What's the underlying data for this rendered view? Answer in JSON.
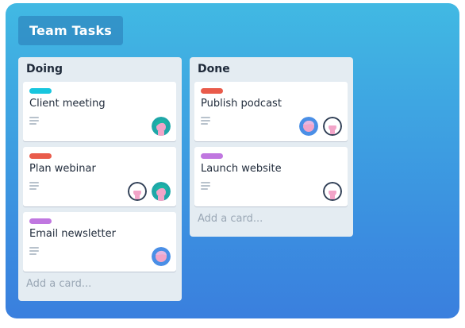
{
  "board": {
    "title": "Team Tasks"
  },
  "lists": [
    {
      "title": "Doing",
      "add_card": "Add a card...",
      "cards": [
        {
          "title": "Client meeting",
          "label_color": "#18c6de",
          "avatars": [
            "avatar-teal-hair"
          ]
        },
        {
          "title": "Plan webinar",
          "label_color": "#e95b4b",
          "avatars": [
            "avatar-dark-outline",
            "avatar-teal-hair"
          ]
        },
        {
          "title": "Email newsletter",
          "label_color": "#c077e0",
          "avatars": [
            "avatar-blue-circle"
          ]
        }
      ]
    },
    {
      "title": "Done",
      "add_card": "Add a card...",
      "cards": [
        {
          "title": "Publish podcast",
          "label_color": "#e95b4b",
          "avatars": [
            "avatar-blue-circle",
            "avatar-dark-outline"
          ]
        },
        {
          "title": "Launch website",
          "label_color": "#c077e0",
          "avatars": [
            "avatar-dark-outline"
          ]
        }
      ]
    }
  ]
}
